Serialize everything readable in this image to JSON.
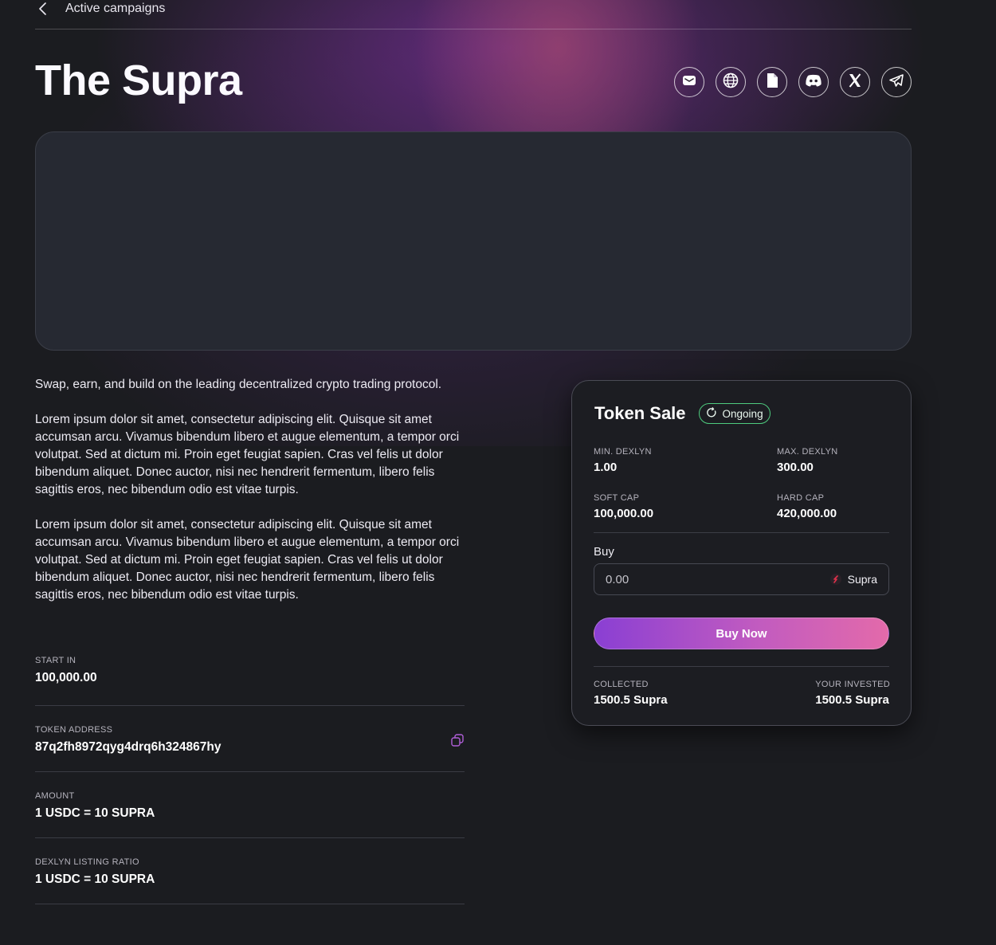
{
  "nav": {
    "back_label": "Active campaigns"
  },
  "project": {
    "title": "The Supra",
    "tagline": "Swap, earn, and build on the leading decentralized crypto trading protocol.",
    "paragraphs": [
      "Lorem ipsum dolor sit amet, consectetur adipiscing elit. Quisque sit amet accumsan arcu. Vivamus bibendum libero et augue elementum, a tempor orci volutpat. Sed at dictum mi. Proin eget feugiat sapien. Cras vel felis ut dolor bibendum aliquet. Donec auctor, nisi nec hendrerit fermentum, libero felis sagittis eros, nec bibendum odio est vitae turpis.",
      "Lorem ipsum dolor sit amet, consectetur adipiscing elit. Quisque sit amet accumsan arcu. Vivamus bibendum libero et augue elementum, a tempor orci volutpat. Sed at dictum mi. Proin eget feugiat sapien. Cras vel felis ut dolor bibendum aliquet. Donec auctor, nisi nec hendrerit fermentum, libero felis sagittis eros, nec bibendum odio est vitae turpis."
    ]
  },
  "socials": [
    "email-icon",
    "globe-icon",
    "document-icon",
    "discord-icon",
    "x-icon",
    "telegram-icon"
  ],
  "info": {
    "start_in": {
      "label": "START IN",
      "value": "100,000.00"
    },
    "token_address": {
      "label": "TOKEN ADDRESS",
      "value": "87q2fh8972qyg4drq6h324867hy"
    },
    "amount": {
      "label": "AMOUNT",
      "value": "1 USDC = 10 SUPRA"
    },
    "listing_ratio": {
      "label": "DEXLYN LISTING RATIO",
      "value": "1 USDC = 10 SUPRA"
    }
  },
  "sale": {
    "title": "Token Sale",
    "status": "Ongoing",
    "min": {
      "label": "MIN. DEXLYN",
      "value": "1.00"
    },
    "max": {
      "label": "MAX. DEXLYN",
      "value": "300.00"
    },
    "soft_cap": {
      "label": "SOFT CAP",
      "value": "100,000.00"
    },
    "hard_cap": {
      "label": "HARD CAP",
      "value": "420,000.00"
    },
    "buy_label": "Buy",
    "buy_placeholder": "0.00",
    "token": "Supra",
    "button_label": "Buy Now",
    "collected": {
      "label": "COLLECTED",
      "value": "1500.5 Supra"
    },
    "invested": {
      "label": "YOUR INVESTED",
      "value": "1500.5 Supra"
    }
  },
  "colors": {
    "background": "#1b1c20",
    "status_green": "#4ecb7e",
    "accent_purple": "#8a3fd3",
    "accent_pink": "#e36aaa",
    "copy_icon": "#b05fd8"
  }
}
